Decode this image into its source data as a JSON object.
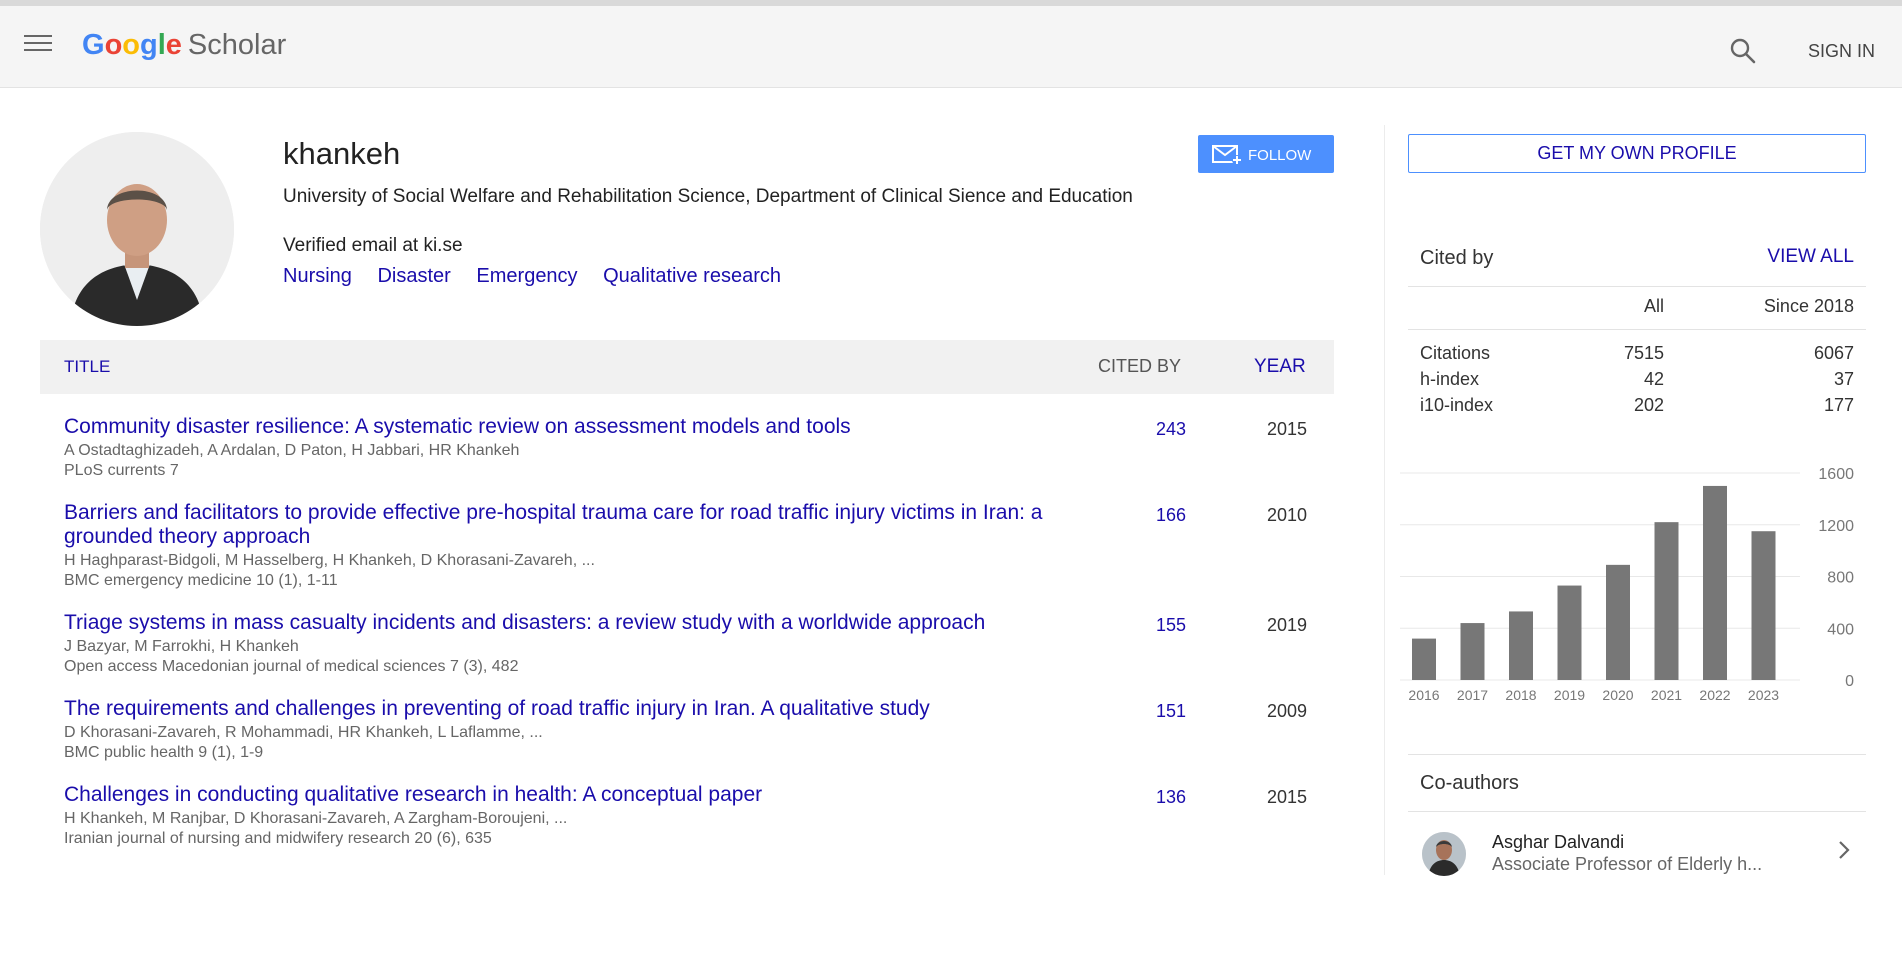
{
  "header": {
    "logo_letters": [
      "G",
      "o",
      "o",
      "g",
      "l",
      "e"
    ],
    "logo_product": "Scholar",
    "sign_in": "SIGN IN"
  },
  "profile": {
    "name": "khankeh",
    "affiliation": "University of Social Welfare and Rehabilitation Science, Department of Clinical Sience and Education",
    "email": "Verified email at ki.se",
    "interests": [
      "Nursing",
      "Disaster",
      "Emergency",
      "Qualitative research"
    ],
    "follow_label": "FOLLOW"
  },
  "table": {
    "col_title": "TITLE",
    "col_cited": "CITED BY",
    "col_year": "YEAR",
    "articles": [
      {
        "title": "Community disaster resilience: A systematic review on assessment models and tools",
        "authors": "A Ostadtaghizadeh, A Ardalan, D Paton, H Jabbari, HR Khankeh",
        "venue": "PLoS currents 7",
        "cited": "243",
        "year": "2015"
      },
      {
        "title": "Barriers and facilitators to provide effective pre-hospital trauma care for road traffic injury victims in Iran: a grounded theory approach",
        "authors": "H Haghparast-Bidgoli, M Hasselberg, H Khankeh, D Khorasani-Zavareh, ...",
        "venue": "BMC emergency medicine 10 (1), 1-11",
        "cited": "166",
        "year": "2010"
      },
      {
        "title": "Triage systems in mass casualty incidents and disasters: a review study with a worldwide approach",
        "authors": "J Bazyar, M Farrokhi, H Khankeh",
        "venue": "Open access Macedonian journal of medical sciences 7 (3), 482",
        "cited": "155",
        "year": "2019"
      },
      {
        "title": "The requirements and challenges in preventing of road traffic injury in Iran. A qualitative study",
        "authors": "D Khorasani-Zavareh, R Mohammadi, HR Khankeh, L Laflamme, ...",
        "venue": "BMC public health 9 (1), 1-9",
        "cited": "151",
        "year": "2009"
      },
      {
        "title": "Challenges in conducting qualitative research in health: A conceptual paper",
        "authors": "H Khankeh, M Ranjbar, D Khorasani-Zavareh, A Zargham-Boroujeni, ...",
        "venue": "Iranian journal of nursing and midwifery research 20 (6), 635",
        "cited": "136",
        "year": "2015"
      }
    ]
  },
  "sidebar": {
    "get_profile": "GET MY OWN PROFILE",
    "cited_by": "Cited by",
    "view_all": "VIEW ALL",
    "col_all": "All",
    "col_since": "Since 2018",
    "stats": [
      {
        "label": "Citations",
        "all": "7515",
        "since": "6067"
      },
      {
        "label": "h-index",
        "all": "42",
        "since": "37"
      },
      {
        "label": "i10-index",
        "all": "202",
        "since": "177"
      }
    ],
    "coauthors_title": "Co-authors",
    "coauthor": {
      "name": "Asghar Dalvandi",
      "affiliation": "Associate Professor of Elderly h..."
    }
  },
  "chart_data": {
    "type": "bar",
    "categories": [
      "2016",
      "2017",
      "2018",
      "2019",
      "2020",
      "2021",
      "2022",
      "2023"
    ],
    "values": [
      320,
      440,
      530,
      730,
      890,
      1220,
      1500,
      1150
    ],
    "yticks": [
      "1600",
      "1200",
      "800",
      "400",
      "0"
    ],
    "ylim": [
      0,
      1600
    ],
    "bar_color": "#777777"
  },
  "colors": {
    "link": "#1a0dab",
    "accent": "#4d90fe",
    "header_bg": "#f5f5f5"
  }
}
